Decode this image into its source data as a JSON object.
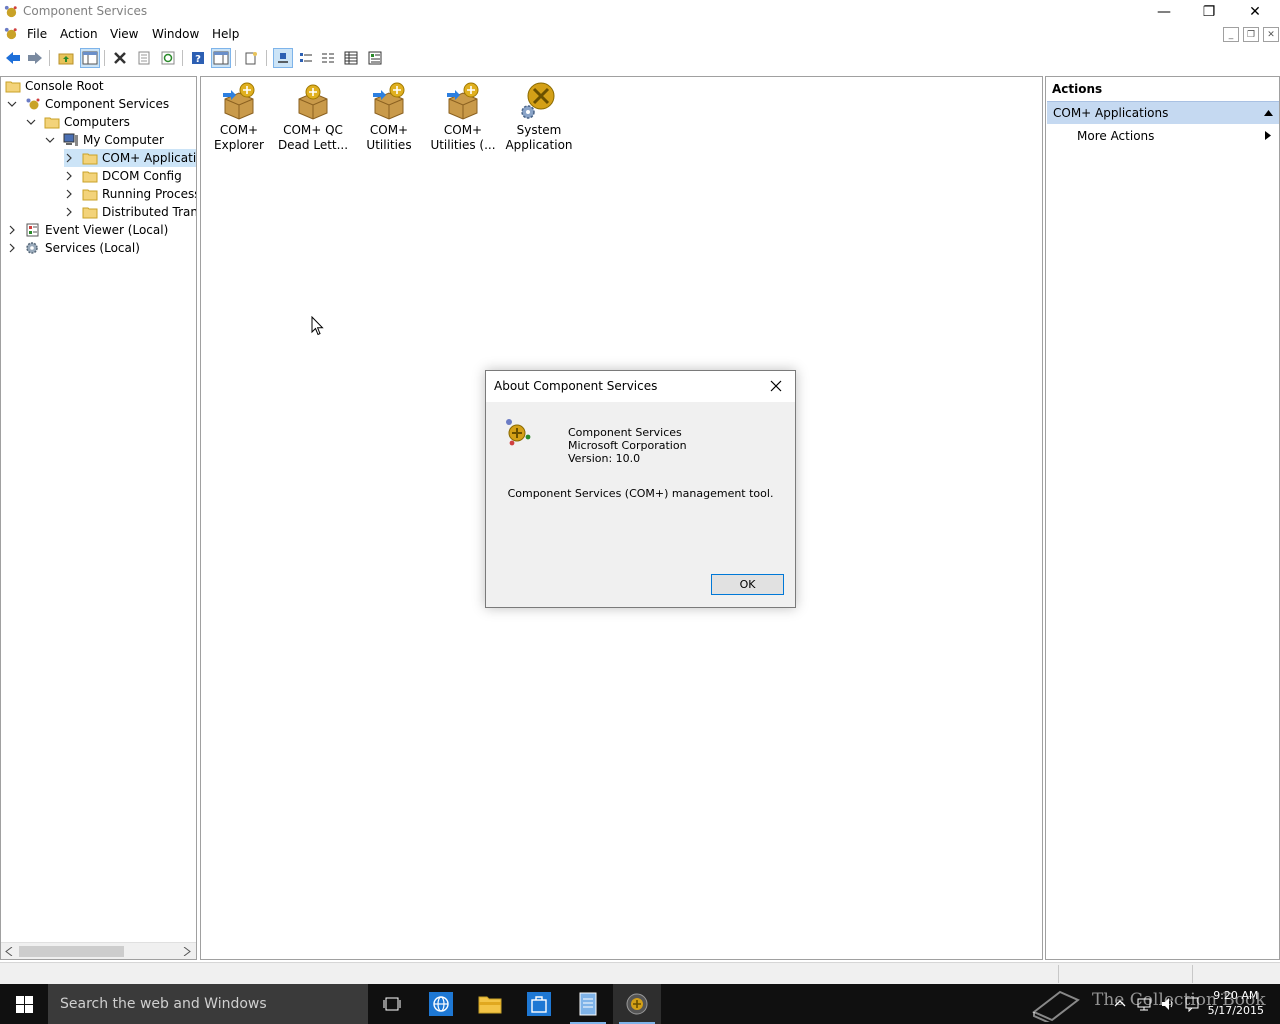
{
  "window": {
    "title": "Component Services",
    "controls": {
      "minimize": "—",
      "restore": "❐",
      "close": "✕"
    }
  },
  "menubar": {
    "items": [
      "File",
      "Action",
      "View",
      "Window",
      "Help"
    ],
    "mdi": {
      "minimize": "_",
      "restore": "❐",
      "close": "✕"
    }
  },
  "tree": {
    "items": [
      {
        "label": "Console Root"
      },
      {
        "label": "Component Services"
      },
      {
        "label": "Computers"
      },
      {
        "label": "My Computer"
      },
      {
        "label": "COM+ Applications"
      },
      {
        "label": "DCOM Config"
      },
      {
        "label": "Running Processes"
      },
      {
        "label": "Distributed Transaction Coordinator"
      },
      {
        "label": "Event Viewer (Local)"
      },
      {
        "label": "Services (Local)"
      }
    ]
  },
  "content": {
    "icons": [
      {
        "line1": "COM+",
        "line2": "Explorer"
      },
      {
        "line1": "COM+ QC",
        "line2": "Dead Lett..."
      },
      {
        "line1": "COM+",
        "line2": "Utilities"
      },
      {
        "line1": "COM+",
        "line2": "Utilities (..."
      },
      {
        "line1": "System",
        "line2": "Application"
      }
    ]
  },
  "actions": {
    "title": "Actions",
    "section": "COM+ Applications",
    "more": "More Actions"
  },
  "dialog": {
    "title": "About Component Services",
    "product": "Component Services",
    "company": "Microsoft Corporation",
    "version": "Version: 10.0",
    "description": "Component Services (COM+) management tool.",
    "ok": "OK"
  },
  "taskbar": {
    "search_placeholder": "Search the web and Windows",
    "time": "9:20 AM",
    "date": "5/17/2015",
    "watermark": "The Collection Book"
  }
}
